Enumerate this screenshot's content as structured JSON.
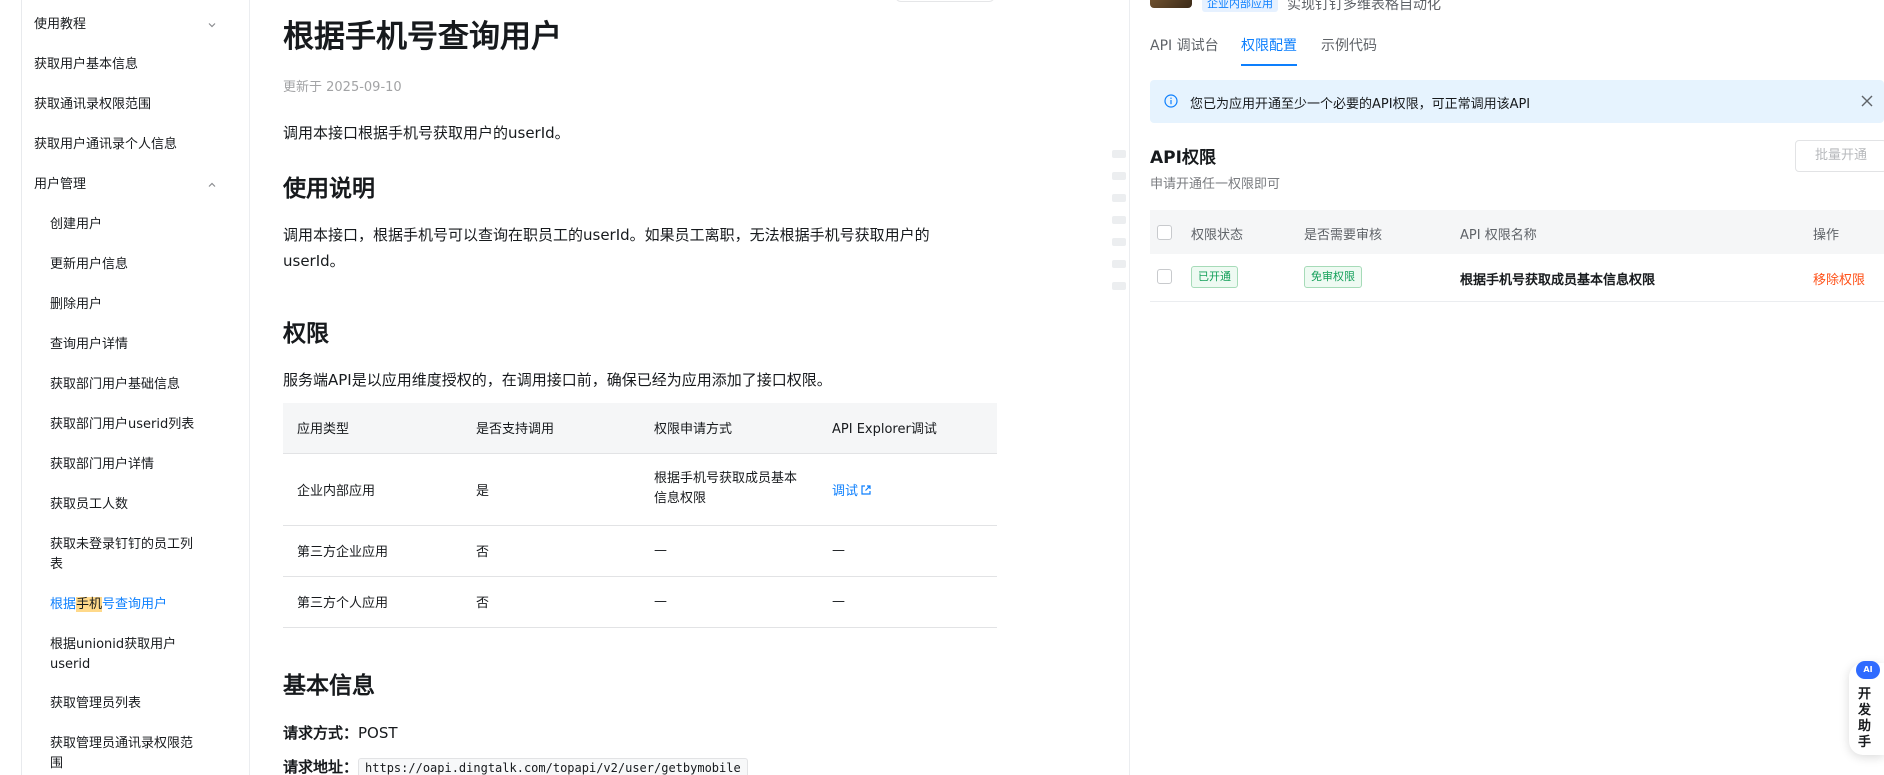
{
  "sidebar": {
    "items": [
      {
        "label": "使用教程",
        "expandable": true,
        "expanded": false
      },
      {
        "label": "获取用户基本信息"
      },
      {
        "label": "获取通讯录权限范围"
      },
      {
        "label": "获取用户通讯录个人信息"
      },
      {
        "label": "用户管理",
        "expandable": true,
        "expanded": true
      },
      {
        "label": "创建用户"
      },
      {
        "label": "更新用户信息"
      },
      {
        "label": "删除用户"
      },
      {
        "label": "查询用户详情"
      },
      {
        "label": "获取部门用户基础信息"
      },
      {
        "label": "获取部门用户userid列表"
      },
      {
        "label": "获取部门用户详情"
      },
      {
        "label": "获取员工人数"
      },
      {
        "label": "获取未登录钉钉的员工列表"
      },
      {
        "label": "根据手机号查询用户",
        "active": true,
        "label_pre": "根据",
        "label_highlight": "手机",
        "label_post": "号查询用户"
      },
      {
        "label": "根据unionid获取用户userid"
      },
      {
        "label": "获取管理员列表"
      },
      {
        "label": "获取管理员通讯录权限范围"
      }
    ]
  },
  "doc": {
    "title": "根据手机号查询用户",
    "updated": "更新于 2025-09-10",
    "intro": "调用本接口根据手机号获取用户的userId。",
    "usage_heading": "使用说明",
    "usage_text": "调用本接口，根据手机号可以查询在职员工的userId。如果员工离职，无法根据手机号获取用户的userId。",
    "perm_heading": "权限",
    "perm_text": "服务端API是以应用维度授权的，在调用接口前，确保已经为应用添加了接口权限。",
    "perm_table": {
      "headers": [
        "应用类型",
        "是否支持调用",
        "权限申请方式",
        "API Explorer调试"
      ],
      "rows": [
        [
          "企业内部应用",
          "是",
          "根据手机号获取成员基本信息权限",
          "调试"
        ],
        [
          "第三方企业应用",
          "否",
          "—",
          "—"
        ],
        [
          "第三方个人应用",
          "否",
          "—",
          "—"
        ]
      ]
    },
    "basic_heading": "基本信息",
    "method_label": "请求方式：",
    "method_value": "POST",
    "url_label": "请求地址：",
    "url_value": "https://oapi.dingtalk.com/topapi/v2/user/getbymobile"
  },
  "panel": {
    "app_tag": "企业内部应用",
    "app_name": "实现钉钉多维表格自动化",
    "tabs": [
      "API 调试台",
      "权限配置",
      "示例代码"
    ],
    "active_tab": "权限配置",
    "notice": "您已为应用开通至少一个必要的API权限，可正常调用该API",
    "api_title": "API权限",
    "api_sub": "申请开通任一权限即可",
    "batch_button": "批量开通",
    "table_headers": [
      "权限状态",
      "是否需要审核",
      "API 权限名称",
      "操作"
    ],
    "row": {
      "status": "已开通",
      "review": "免审权限",
      "name": "根据手机号获取成员基本信息权限",
      "action": "移除权限"
    }
  },
  "helper": {
    "badge": "AI",
    "label": "开发助手"
  },
  "colors": {
    "accent": "#0d7ffd",
    "danger": "#ff5219",
    "success": "#14a05a",
    "notice_bg": "#e6f3fe"
  }
}
